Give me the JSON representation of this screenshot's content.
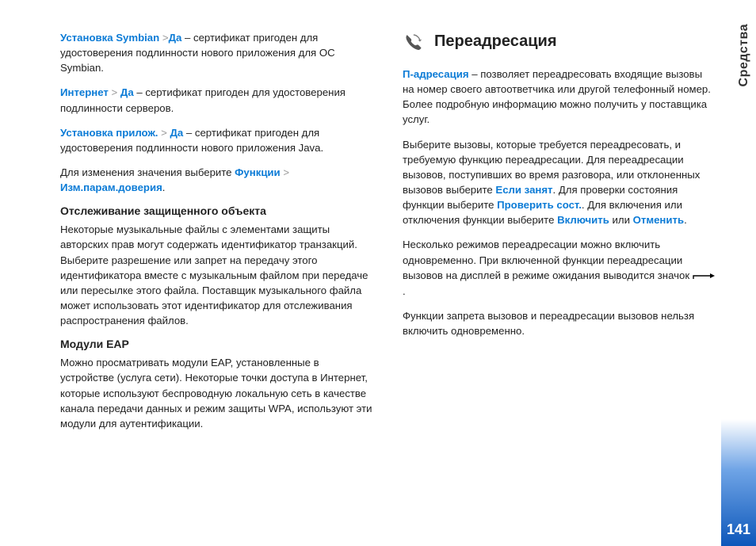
{
  "side": {
    "label": "Средства",
    "page": "141"
  },
  "left": {
    "p1": {
      "l1": "Установка Symbian",
      "sep1": " >",
      "l2": "Да",
      "rest1": " – сертификат пригоден для удостоверения подлинности нового приложения для ОС Symbian."
    },
    "p2": {
      "l1": "Интернет",
      "sep1": " > ",
      "l2": "Да",
      "rest1": " – сертификат пригоден для удостоверения подлинности серверов."
    },
    "p3": {
      "l1": "Установка прилож.",
      "sep1": " > ",
      "l2": "Да",
      "rest1": " – сертификат пригоден для удостоверения подлинности нового приложения Java."
    },
    "p4": {
      "t1": "Для изменения значения выберите ",
      "l1": "Функции",
      "sep1": " > ",
      "l2": "Изм.парам.доверия",
      "dot": "."
    },
    "h1": "Отслеживание защищенного объекта",
    "p5": "Некоторые музыкальные файлы с элементами защиты авторских прав могут содержать идентификатор транзакций. Выберите разрешение или запрет на передачу этого идентификатора вместе с музыкальным файлом при передаче или пересылке этого файла. Поставщик музыкального файла может использовать этот идентификатор для отслеживания распространения файлов.",
    "h2": "Модули EAP",
    "p6": "Можно просматривать модули EAP, установленные в устройстве (услуга сети). Некоторые точки доступа в Интернет, которые используют беспроводную локальную сеть в качестве канала передачи данных и режим защиты WPA, используют эти модули для аутентификации."
  },
  "right": {
    "title": "Переадресация",
    "p1": {
      "l1": "П-адресация",
      "rest": " – позволяет переадресовать входящие вызовы на номер своего автоответчика или другой телефонный номер. Более подробную информацию можно получить у поставщика услуг."
    },
    "p2": {
      "t1": "Выберите вызовы, которые требуется переадресовать, и требуемую функцию переадресации. Для переадресации вызовов, поступивших во время разговора, или отклоненных вызовов выберите ",
      "l1": "Если занят",
      "t2": ". Для проверки состояния функции выберите ",
      "l2": "Проверить сост.",
      "t3": ". Для включения или отключения функции выберите ",
      "l3": "Включить",
      "t4": " или ",
      "l4": "Отменить",
      "t5": "."
    },
    "p3a": "Несколько режимов переадресации можно включить одновременно. При включенной функции переадресации вызовов на дисплей в режиме ожидания выводится значок ",
    "p3b": " .",
    "p4": "Функции запрета вызовов и переадресации вызовов нельзя включить одновременно."
  }
}
